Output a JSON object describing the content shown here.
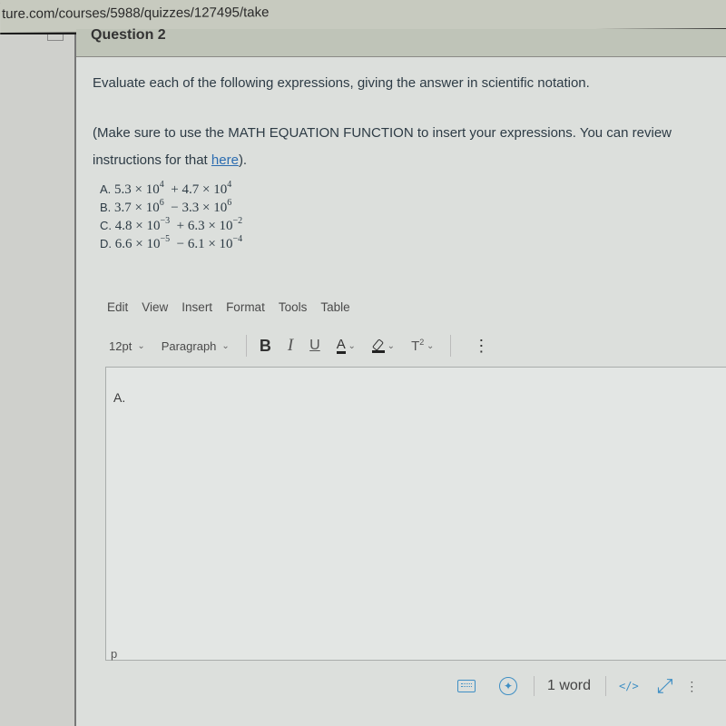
{
  "browser": {
    "url": "ture.com/courses/5988/quizzes/127495/take"
  },
  "question": {
    "title": "Question 2",
    "prompt": "Evaluate each of the following expressions, giving the answer in scientific notation.",
    "instructions_line1": "(Make sure to use the MATH EQUATION FUNCTION to insert your expressions. You can review",
    "instructions_line2_prefix": "instructions for that ",
    "instructions_link": "here",
    "instructions_line2_suffix": ").",
    "expressions": [
      {
        "label": "A.",
        "a": "5.3",
        "ae": "4",
        "op": "+",
        "b": "4.7",
        "be": "4"
      },
      {
        "label": "B.",
        "a": "3.7",
        "ae": "6",
        "op": "−",
        "b": "3.3",
        "be": "6"
      },
      {
        "label": "C.",
        "a": "4.8",
        "ae": "−3",
        "op": "+",
        "b": "6.3",
        "be": "−2"
      },
      {
        "label": "D.",
        "a": "6.6",
        "ae": "−5",
        "op": "−",
        "b": "6.1",
        "be": "−4"
      }
    ],
    "times": "×",
    "ten": "10"
  },
  "editor": {
    "menu": [
      "Edit",
      "View",
      "Insert",
      "Format",
      "Tools",
      "Table"
    ],
    "font_size": "12pt",
    "block_format": "Paragraph",
    "bold": "B",
    "italic": "I",
    "underline": "U",
    "text_color": "A",
    "superscript": "T",
    "superscript_mark": "2",
    "more": "⋮",
    "content": "A.",
    "path": "p",
    "word_count": "1 word",
    "html_toggle": "</>",
    "expand": "⤢",
    "accent_color": "#3f8fc4"
  }
}
